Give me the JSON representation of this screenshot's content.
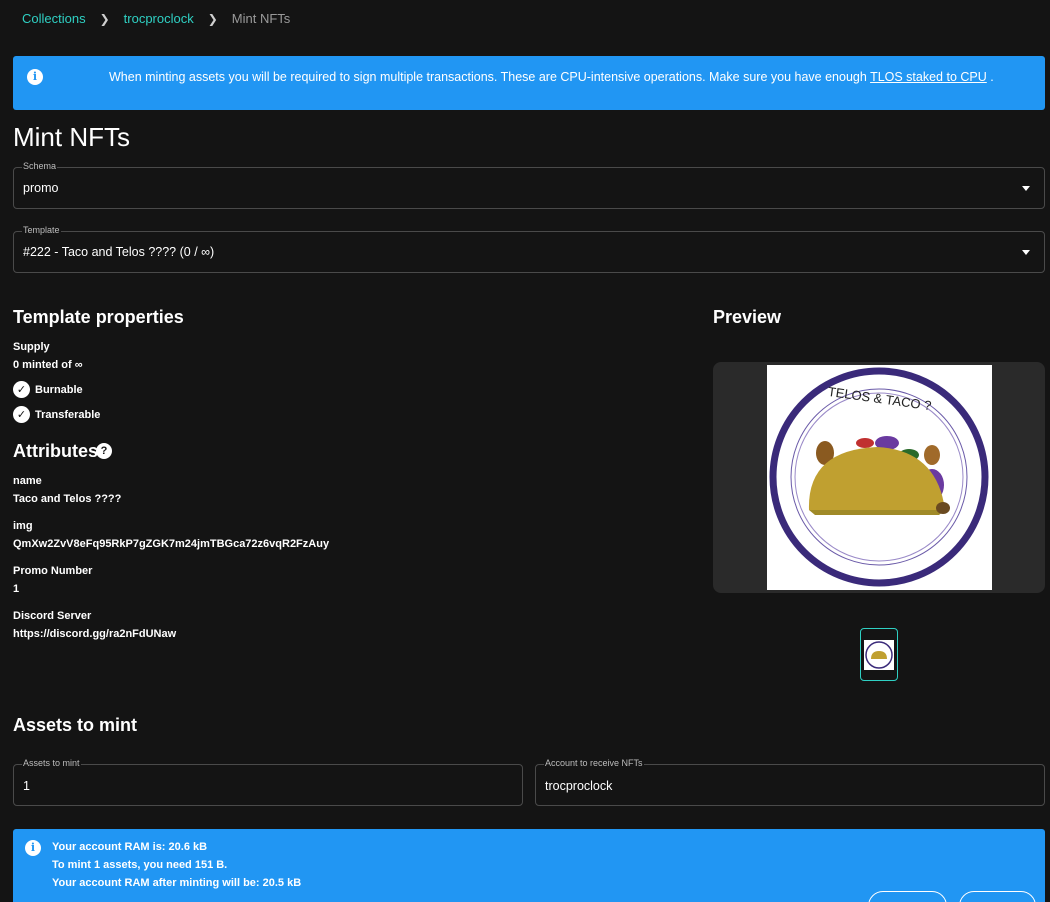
{
  "breadcrumb": {
    "items": [
      "Collections",
      "trocproclock"
    ],
    "current": "Mint NFTs"
  },
  "banner": {
    "text": "When minting assets you will be required to sign multiple transactions. These are CPU-intensive operations. Make sure you have enough",
    "link": "TLOS staked to CPU",
    "suffix": " ."
  },
  "page_title": "Mint NFTs",
  "schema": {
    "label": "Schema",
    "value": "promo"
  },
  "template": {
    "label": "Template",
    "value": "#222 - Taco and Telos ???? (0 / ∞)"
  },
  "template_properties": {
    "title": "Template properties",
    "supply_label": "Supply",
    "supply_value": "0 minted of ∞",
    "burnable": "Burnable",
    "transferable": "Transferable"
  },
  "attributes": {
    "title": "Attributes",
    "items": [
      {
        "name": "name",
        "value": "Taco and Telos ????"
      },
      {
        "name": "img",
        "value": "QmXw2ZvV8eFq95RkP7gZGK7m24jmTBGca72z6vqR2FzAuy"
      },
      {
        "name": "Promo Number",
        "value": "1"
      },
      {
        "name": "Discord Server",
        "value": "https://discord.gg/ra2nFdUNaw"
      }
    ]
  },
  "preview": {
    "title": "Preview",
    "image_text": "TELOS & TACO ?"
  },
  "assets_section": {
    "title": "Assets to mint",
    "assets_label": "Assets to mint",
    "assets_value": "1",
    "account_label": "Account to receive NFTs",
    "account_value": "trocproclock"
  },
  "ram": {
    "line1": "Your account RAM is: 20.6 kB",
    "line2": "To mint 1 assets, you need 151 B.",
    "line3": "Your account RAM after minting will be: 20.5 kB"
  },
  "colors": {
    "accent": "#2fd0c3",
    "info": "#2196f3",
    "background": "#141414"
  },
  "icons": {
    "info": "info-icon",
    "check": "check-circle-icon",
    "help": "help-icon",
    "caret": "caret-down-icon",
    "chevron": "chevron-right-icon"
  }
}
